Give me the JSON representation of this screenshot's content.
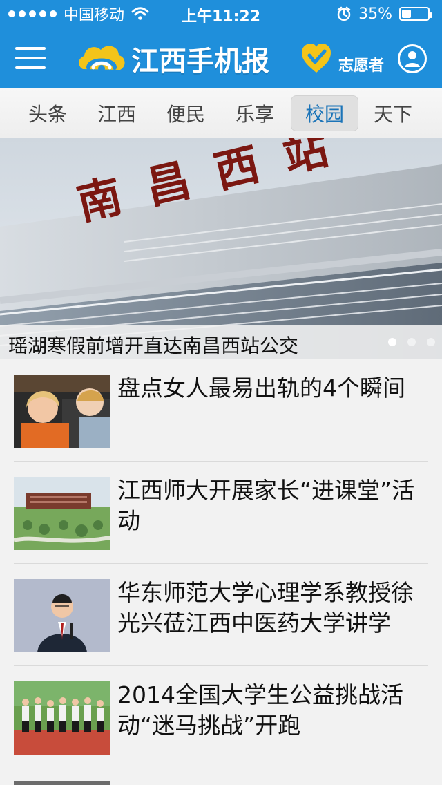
{
  "status": {
    "carrier": "中国移动",
    "time": "上午11:22",
    "battery": "35%",
    "battery_level": 0.35
  },
  "app": {
    "title": "江西手机报",
    "volunteer": "志愿者"
  },
  "tabs": [
    {
      "label": "头条",
      "active": false
    },
    {
      "label": "江西",
      "active": false
    },
    {
      "label": "便民",
      "active": false
    },
    {
      "label": "乐享",
      "active": false
    },
    {
      "label": "校园",
      "active": true
    },
    {
      "label": "天下",
      "active": false
    }
  ],
  "hero": {
    "caption": "瑶湖寒假前增开直达南昌西站公交",
    "pagination": {
      "count": 3,
      "active_index": 0
    },
    "sign_text": "南昌西站"
  },
  "news": [
    {
      "title": "盘点女人最易出轨的4个瞬间",
      "thumb": "people-thumb"
    },
    {
      "title": "江西师大开展家长“进课堂”活动",
      "thumb": "campus-thumb"
    },
    {
      "title": "华东师范大学心理学系教授徐光兴莅江西中医药大学讲学",
      "thumb": "lecture-thumb"
    },
    {
      "title": "2014全国大学生公益挑战活动“迷马挑战”开跑",
      "thumb": "runners-thumb"
    }
  ],
  "colors": {
    "primary": "#1f8fdb",
    "tab_active": "#1b74b8",
    "logo_yellow": "#f3c41a"
  }
}
